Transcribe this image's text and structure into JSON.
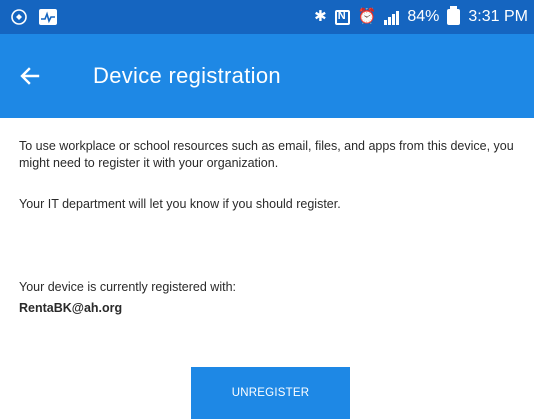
{
  "status_bar": {
    "left_icons": [
      "notification-icon",
      "activity-monitor-icon"
    ],
    "right_icons": [
      "bluetooth-icon",
      "nfc-icon",
      "alarm-icon",
      "lte-signal-icon",
      "battery-icon"
    ],
    "battery": "84%",
    "time": "3:31 PM"
  },
  "app_bar": {
    "back_icon": "arrow-left-icon",
    "title": "Device registration",
    "color": "#1e88e5"
  },
  "content": {
    "intro": "To use workplace or school resources such as email, files, and apps from this device, you might need to register it with your organization.",
    "it_note": "Your IT department will let you know if you should register.",
    "registered_label": "Your device is currently registered with:",
    "registered_account": "RentaBK@ah.org"
  },
  "actions": {
    "unregister_label": "UNREGISTER"
  }
}
